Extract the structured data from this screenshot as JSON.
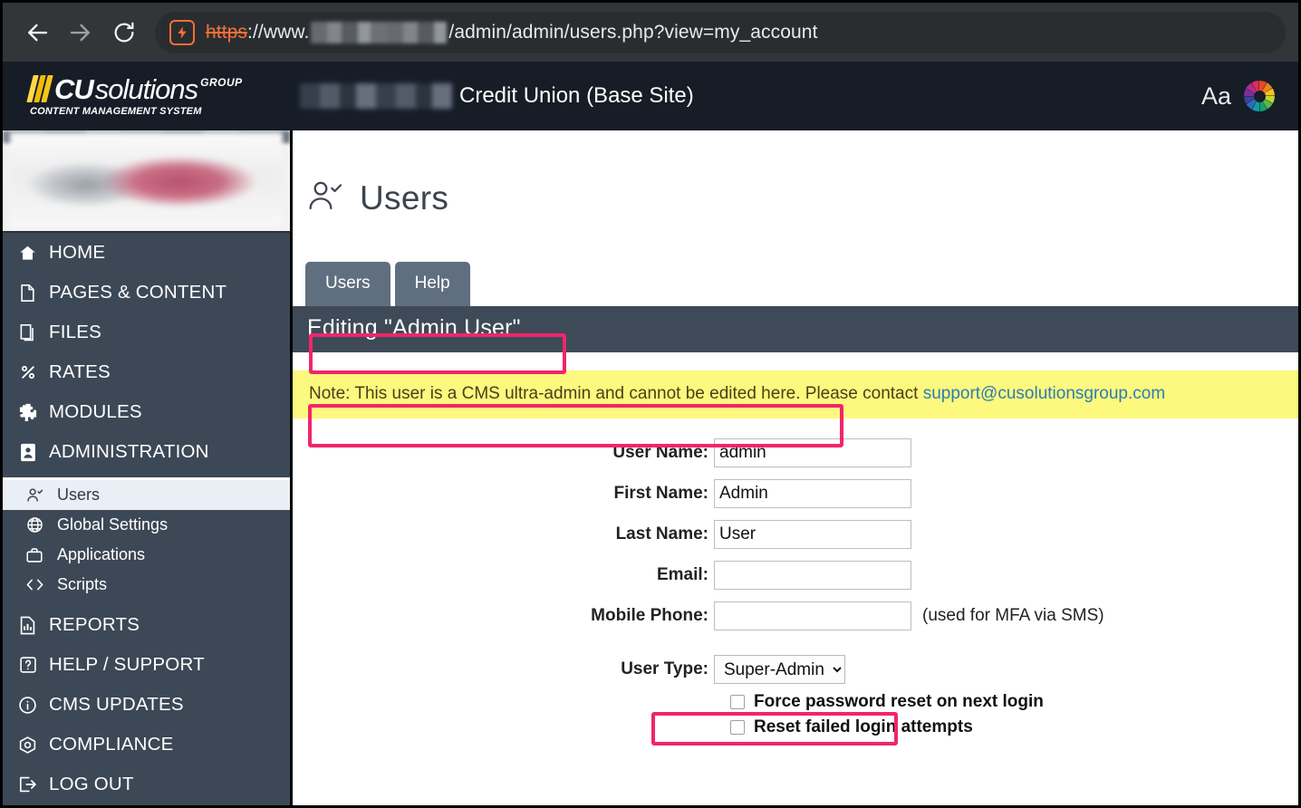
{
  "browser": {
    "back_label": "Back",
    "forward_label": "Forward",
    "reload_label": "Reload",
    "security_label": "Not secure",
    "url_scheme": "https",
    "url_separator": "://www.",
    "url_redacted": "",
    "url_path": "/admin/admin/users.php?view=my_account"
  },
  "header": {
    "logo_cu": "CU",
    "logo_solutions": "solutions",
    "logo_group": "GROUP",
    "logo_subtitle": "CONTENT MANAGEMENT SYSTEM",
    "site_name_redacted": "",
    "site_name": "Credit Union (Base Site)",
    "font_size_label": "Aa",
    "color_wheel_label": "Color theme"
  },
  "sidebar": {
    "logo_alt": "Credit union logo",
    "items": [
      {
        "label": "HOME",
        "icon": "home-icon"
      },
      {
        "label": "PAGES & CONTENT",
        "icon": "page-icon"
      },
      {
        "label": "FILES",
        "icon": "files-icon"
      },
      {
        "label": "RATES",
        "icon": "percent-icon"
      },
      {
        "label": "MODULES",
        "icon": "puzzle-icon"
      },
      {
        "label": "ADMINISTRATION",
        "icon": "id-badge-icon"
      }
    ],
    "sub_items": [
      {
        "label": "Users",
        "icon": "user-check-icon",
        "active": true
      },
      {
        "label": "Global Settings",
        "icon": "globe-icon",
        "active": false
      },
      {
        "label": "Applications",
        "icon": "briefcase-icon",
        "active": false
      },
      {
        "label": "Scripts",
        "icon": "code-icon",
        "active": false
      }
    ],
    "items_bottom": [
      {
        "label": "REPORTS",
        "icon": "chart-document-icon"
      },
      {
        "label": "HELP / SUPPORT",
        "icon": "question-box-icon"
      },
      {
        "label": "CMS UPDATES",
        "icon": "info-circle-icon"
      },
      {
        "label": "COMPLIANCE",
        "icon": "shield-check-icon"
      },
      {
        "label": "LOG OUT",
        "icon": "logout-icon"
      }
    ]
  },
  "main": {
    "page_title": "Users",
    "page_title_icon": "user-check-icon",
    "tabs": [
      {
        "label": "Users",
        "active": true
      },
      {
        "label": "Help",
        "active": false
      }
    ],
    "editing_bar": "Editing \"Admin User\"",
    "notice": {
      "text": "Note: This user is a CMS ultra-admin and cannot be edited here. Please contact ",
      "link": "support@cusolutionsgroup.com"
    },
    "form": {
      "fields": [
        {
          "label": "User Name:",
          "value": "admin",
          "placeholder": "",
          "hint": ""
        },
        {
          "label": "First Name:",
          "value": "Admin",
          "placeholder": "",
          "hint": ""
        },
        {
          "label": "Last Name:",
          "value": "User",
          "placeholder": "",
          "hint": ""
        },
        {
          "label": "Email:",
          "value": "",
          "placeholder": "",
          "hint": ""
        },
        {
          "label": "Mobile Phone:",
          "value": "",
          "placeholder": "",
          "hint": "(used for MFA via SMS)"
        }
      ],
      "user_type_label": "User Type:",
      "user_type_value": "Super-Admin",
      "user_type_options": [
        "Super-Admin"
      ],
      "checkboxes": [
        {
          "label": "Force password reset on next login",
          "checked": false
        },
        {
          "label": "Reset failed login attempts",
          "checked": false
        }
      ]
    }
  },
  "annotations": {
    "color": "#f2256a",
    "boxes": [
      {
        "name": "editing-title-highlight"
      },
      {
        "name": "notice-highlight"
      },
      {
        "name": "user-type-highlight"
      }
    ]
  }
}
